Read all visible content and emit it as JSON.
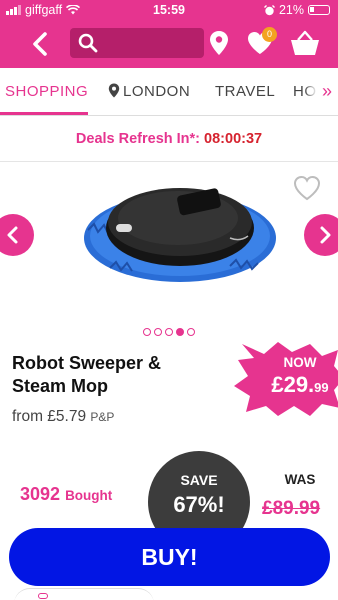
{
  "status_bar": {
    "carrier": "giffgaff",
    "time": "15:59",
    "battery": "21%"
  },
  "header": {
    "notification_count": "0"
  },
  "tabs": [
    {
      "label": "SHOPPING"
    },
    {
      "label": "LONDON"
    },
    {
      "label": "TRAVEL"
    },
    {
      "label": "HOME"
    }
  ],
  "deals": {
    "label": "Deals Refresh In*:",
    "timer": "08:00:37"
  },
  "product": {
    "title": "Robot Sweeper & Steam Mop",
    "from_label": "from £5.79",
    "pp_label": "P&P",
    "now_label": "NOW",
    "now_price_main": "£29.",
    "now_price_pence": "99",
    "bought_count": "3092",
    "bought_label": "Bought",
    "save_label": "SAVE",
    "save_value": "67%!",
    "was_label": "WAS",
    "was_price": "£89.99",
    "image_slides": 5,
    "active_slide": 4
  },
  "buy_label": "BUY!",
  "colors": {
    "brand_pink": "#e6348f",
    "buy_blue": "#0216e4",
    "save_dark": "#3c3c3c"
  }
}
